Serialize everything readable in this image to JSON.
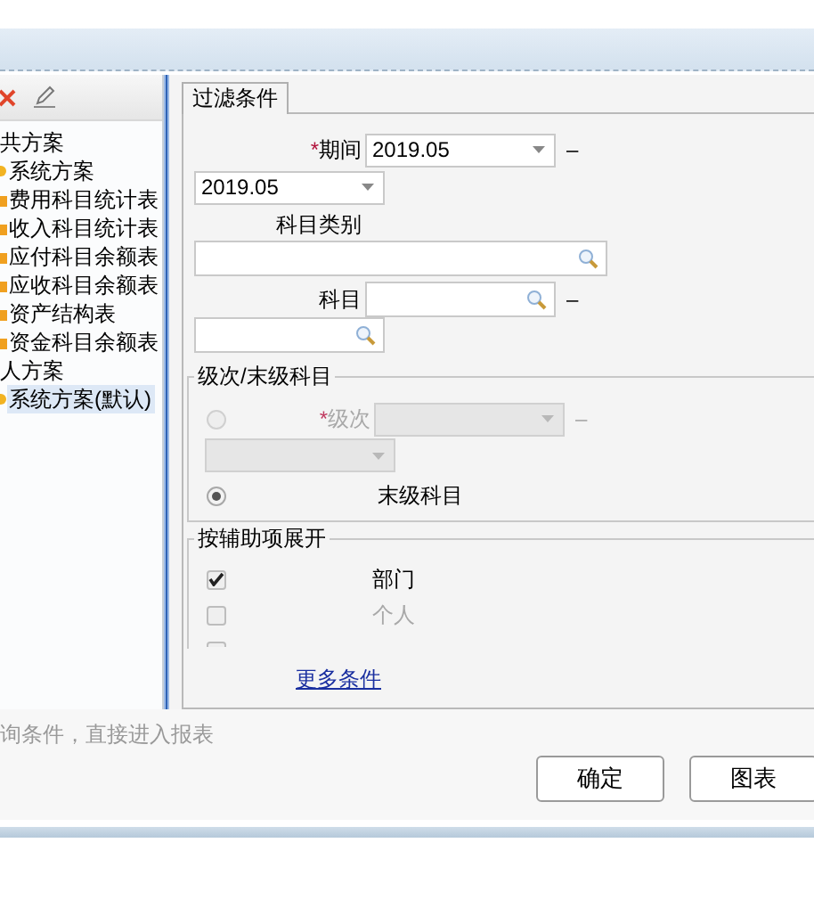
{
  "tree": [
    {
      "label": "共方案",
      "children": [
        {
          "label": "系统方案",
          "kind": "scheme",
          "selected": false
        },
        {
          "label": "费用科目统计表",
          "kind": "report",
          "selected": false
        },
        {
          "label": "收入科目统计表",
          "kind": "report",
          "selected": false
        },
        {
          "label": "应付科目余额表",
          "kind": "report",
          "selected": false
        },
        {
          "label": "应收科目余额表",
          "kind": "report",
          "selected": false
        },
        {
          "label": "资产结构表",
          "kind": "report",
          "selected": false
        },
        {
          "label": "资金科目余额表",
          "kind": "report",
          "selected": false
        }
      ]
    },
    {
      "label": "人方案",
      "children": [
        {
          "label": "系统方案(默认)",
          "kind": "scheme",
          "selected": true
        }
      ]
    }
  ],
  "tabs": [
    {
      "label": "过滤条件",
      "selected": true
    }
  ],
  "form": {
    "period": {
      "required_mark": "*",
      "label": "期间",
      "from": "2019.05",
      "separator": "–",
      "to": "2019.05"
    },
    "subject_category": {
      "label": "科目类别"
    },
    "subject": {
      "label": "科目",
      "separator": "–"
    },
    "level_group": {
      "title": "级次/末级科目",
      "options": [
        {
          "kind": "level",
          "required_mark": "*",
          "label": "级次",
          "selected": false,
          "disabled": true,
          "separator": "–"
        },
        {
          "kind": "leaf",
          "label": "末级科目",
          "selected": true,
          "disabled": false
        }
      ]
    },
    "aux_group": {
      "title": "按辅助项展开",
      "items": [
        {
          "label": "部门",
          "checked": true
        },
        {
          "label": "个人",
          "checked": false
        },
        {
          "checked": false
        }
      ]
    },
    "more_link": "更多条件"
  },
  "hint": "询条件，直接进入报表",
  "buttons": [
    "确定",
    "图表"
  ]
}
